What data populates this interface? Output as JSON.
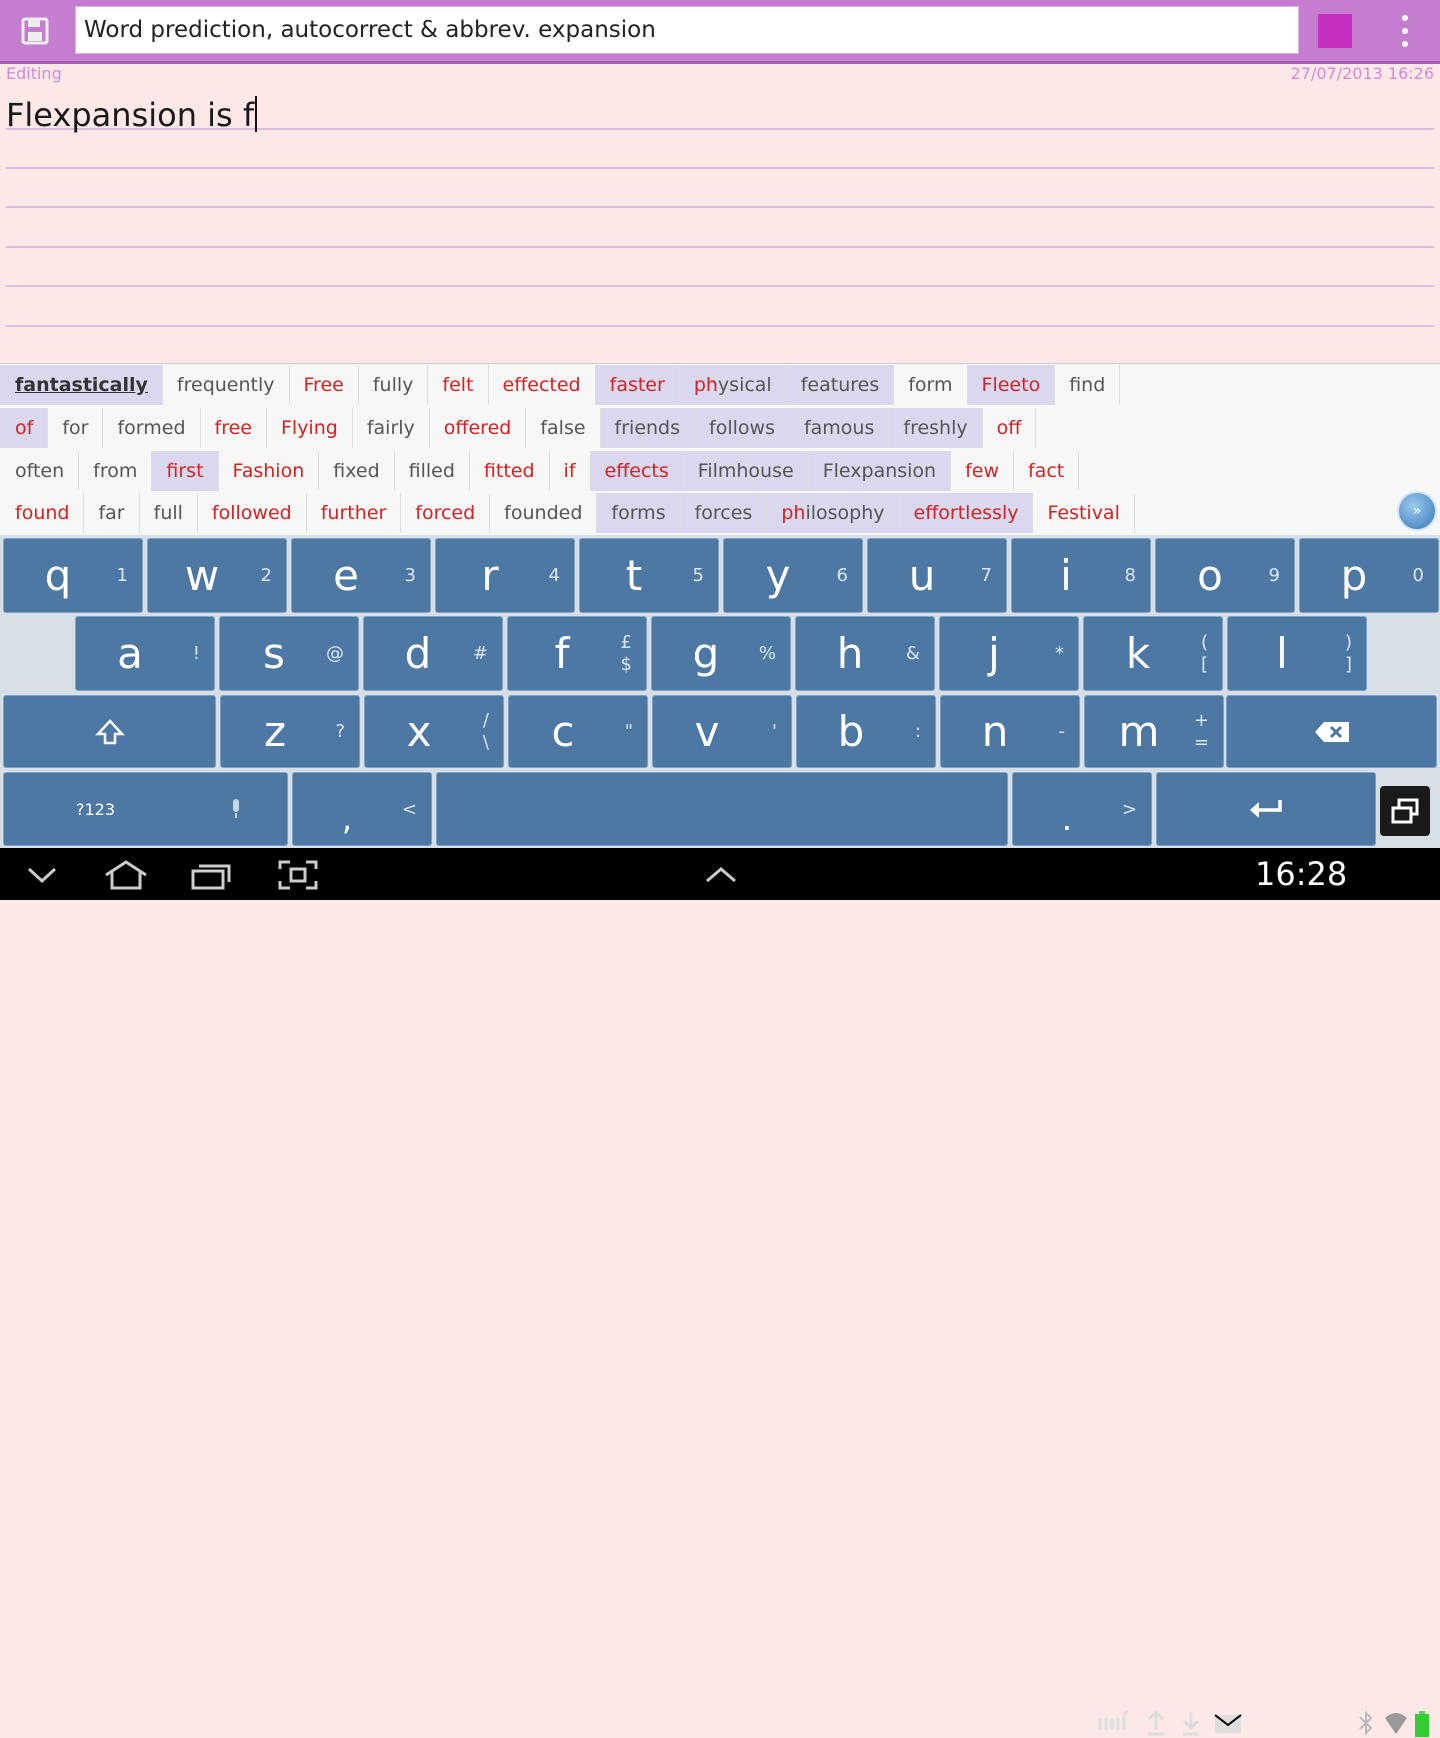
{
  "toolbar": {
    "title": "Word prediction, autocorrect & abbrev. expansion",
    "save_icon": "floppy-disk-icon",
    "color_swatch": "#c62fbf",
    "menu_icon": "overflow-menu-icon"
  },
  "status": {
    "mode": "Editing",
    "timestamp": "27/07/2013 16:26"
  },
  "editor": {
    "text": "Flexpansion is f"
  },
  "suggestions": {
    "row1": [
      "fantastically",
      "frequently",
      "Free",
      "fully",
      "felt",
      "effected",
      "faster",
      "physical",
      "features",
      "form",
      "Fleeto",
      "find"
    ],
    "row2": [
      "of",
      "for",
      "formed",
      "free",
      "Flying",
      "fairly",
      "offered",
      "false",
      "friends",
      "follows",
      "famous",
      "freshly",
      "off"
    ],
    "row3": [
      "often",
      "from",
      "first",
      "Fashion",
      "fixed",
      "filled",
      "fitted",
      "if",
      "effects",
      "Filmhouse",
      "Flexpansion",
      "few",
      "fact"
    ],
    "row4": [
      "found",
      "far",
      "full",
      "followed",
      "further",
      "forced",
      "founded",
      "forms",
      "forces",
      "philosophy",
      "effortlessly",
      "Festival"
    ]
  },
  "keyboard": {
    "row1": [
      {
        "k": "q",
        "a": "1"
      },
      {
        "k": "w",
        "a": "2"
      },
      {
        "k": "e",
        "a": "3"
      },
      {
        "k": "r",
        "a": "4"
      },
      {
        "k": "t",
        "a": "5"
      },
      {
        "k": "y",
        "a": "6"
      },
      {
        "k": "u",
        "a": "7"
      },
      {
        "k": "i",
        "a": "8"
      },
      {
        "k": "o",
        "a": "9"
      },
      {
        "k": "p",
        "a": "0"
      }
    ],
    "row2": [
      {
        "k": "a",
        "a": "!"
      },
      {
        "k": "s",
        "a": "@"
      },
      {
        "k": "d",
        "a": "#"
      },
      {
        "k": "f",
        "a": "£ $"
      },
      {
        "k": "g",
        "a": "%"
      },
      {
        "k": "h",
        "a": "&"
      },
      {
        "k": "j",
        "a": "*"
      },
      {
        "k": "k",
        "a": "( ["
      },
      {
        "k": "l",
        "a": ") ]"
      }
    ],
    "row3": [
      {
        "k": "z",
        "a": "?"
      },
      {
        "k": "x",
        "a": "/ \\"
      },
      {
        "k": "c",
        "a": "\""
      },
      {
        "k": "v",
        "a": "'"
      },
      {
        "k": "b",
        "a": ":"
      },
      {
        "k": "n",
        "a": "-"
      },
      {
        "k": "m",
        "a": "+ ="
      }
    ],
    "symbols_label": "?123",
    "comma": ",",
    "comma_alt": "<",
    "period": ".",
    "period_alt": ">"
  },
  "system": {
    "time": "16:28"
  }
}
